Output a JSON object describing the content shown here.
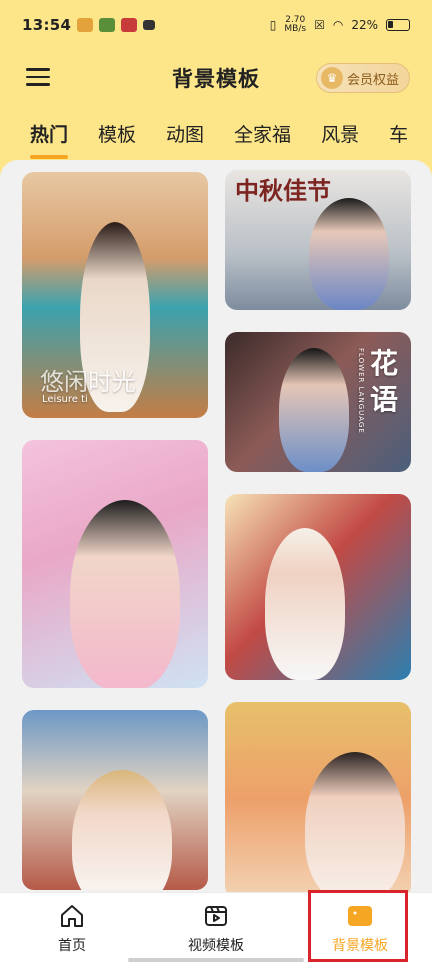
{
  "status": {
    "time": "13:54",
    "speed_value": "2.70",
    "speed_unit": "MB/s",
    "battery": "22%"
  },
  "app_bar": {
    "title": "背景模板",
    "vip_label": "会员权益"
  },
  "tabs": [
    "热门",
    "模板",
    "动图",
    "全家福",
    "风景",
    "车"
  ],
  "active_tab": 0,
  "cards": [
    {
      "caption": "悠闲时光",
      "subcaption": "Leisure ti"
    },
    {
      "caption": "中秋佳节"
    },
    {
      "caption": "花语",
      "subcaption": "FLOWER LANGUAGE"
    },
    {},
    {},
    {},
    {}
  ],
  "bottom_nav": [
    {
      "label": "首页",
      "icon": "home-icon"
    },
    {
      "label": "视频模板",
      "icon": "video-template-icon"
    },
    {
      "label": "背景模板",
      "icon": "image-icon"
    }
  ],
  "colors": {
    "header_bg": "#fde68a",
    "accent": "#f5a623",
    "highlight": "#d9242b"
  }
}
